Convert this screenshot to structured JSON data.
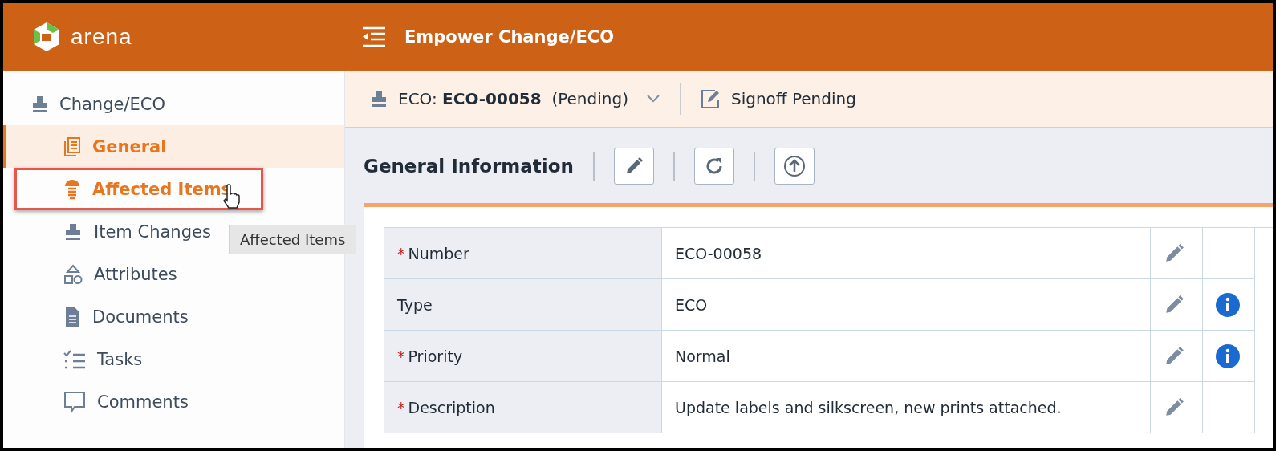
{
  "header": {
    "logo_text": "arena",
    "title": "Empower Change/ECO"
  },
  "sidebar": {
    "heading": "Change/ECO",
    "items": [
      {
        "label": "General",
        "kind": "pages",
        "selected": true,
        "hovered": false
      },
      {
        "label": "Affected Items",
        "kind": "screw",
        "selected": false,
        "hovered": true
      },
      {
        "label": "Item Changes",
        "kind": "stamp",
        "selected": false,
        "hovered": false
      },
      {
        "label": "Attributes",
        "kind": "shapes",
        "selected": false,
        "hovered": false
      },
      {
        "label": "Documents",
        "kind": "doc",
        "selected": false,
        "hovered": false
      },
      {
        "label": "Tasks",
        "kind": "tasks",
        "selected": false,
        "hovered": false
      },
      {
        "label": "Comments",
        "kind": "comment",
        "selected": false,
        "hovered": false
      }
    ]
  },
  "tooltip": "Affected Items",
  "record_bar": {
    "prefix": "ECO:",
    "number": "ECO-00058",
    "status": "(Pending)",
    "signoff": "Signoff Pending"
  },
  "section": {
    "title": "General Information"
  },
  "fields": [
    {
      "label": "Number",
      "required_mark": "*",
      "value": "ECO-00058",
      "info": false
    },
    {
      "label": "Type",
      "value": "ECO",
      "info": true
    },
    {
      "label": "Priority",
      "required_mark": "*",
      "value": "Normal",
      "info": true
    },
    {
      "label": "Description",
      "required_mark": "*",
      "value": "Update labels and silkscreen, new prints attached.",
      "info": false
    }
  ]
}
